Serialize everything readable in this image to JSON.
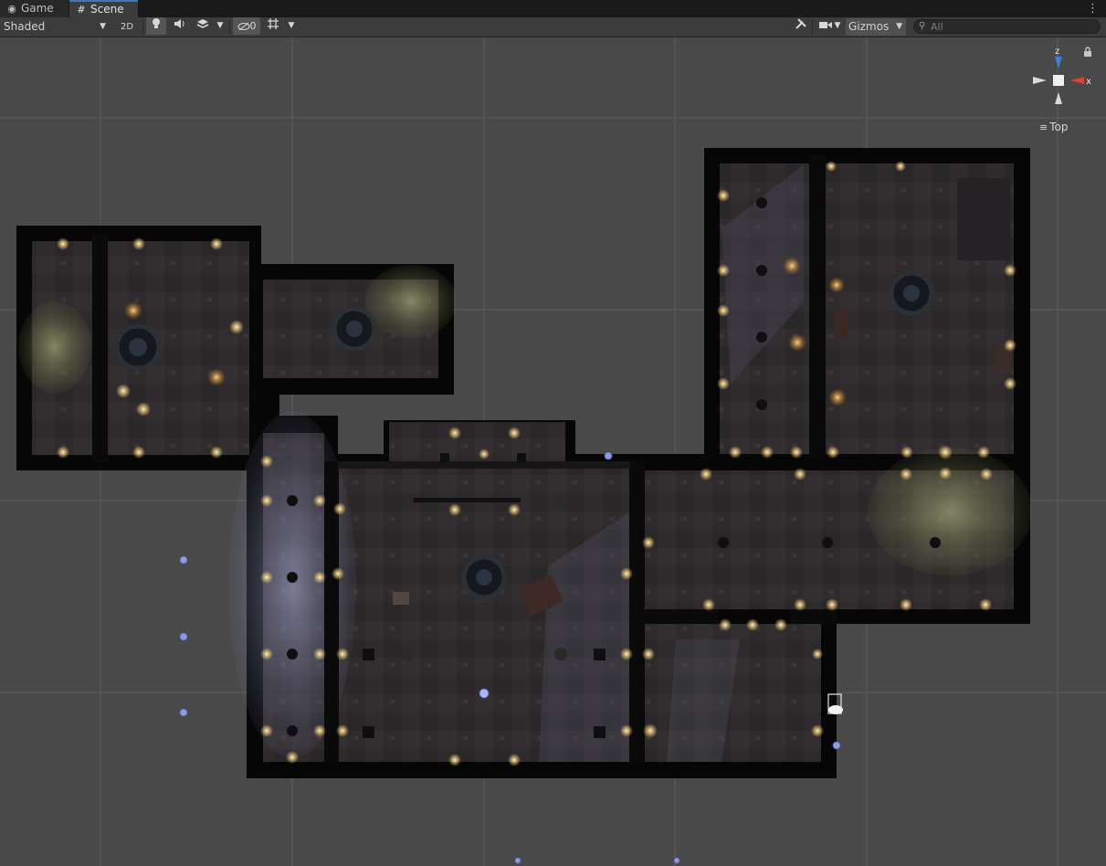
{
  "tabs": [
    {
      "label": "Game",
      "icon": "gamepad-icon"
    },
    {
      "label": "Scene",
      "icon": "hash-icon"
    }
  ],
  "toolbar": {
    "shading_mode": "Shaded",
    "mode_2d_label": "2D",
    "hidden_count": "0",
    "gizmos_label": "Gizmos",
    "search_placeholder": "All"
  },
  "orientation": {
    "axis_z": "z",
    "axis_x": "x",
    "view_label": "Top"
  },
  "colors": {
    "accent": "#3a79bb",
    "background": "#494949",
    "x_axis": "#e0412f",
    "z_axis": "#3b7ed9",
    "light_glow": "#f2d9a0"
  }
}
